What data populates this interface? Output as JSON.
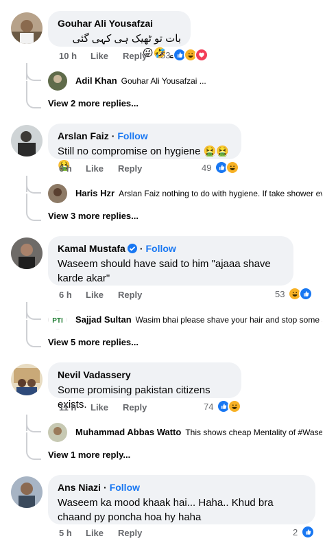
{
  "comments": [
    {
      "author": "Gouhar Ali Yousafzai",
      "text": "بات تو ٹھیک ہی کہی گئی ہے 🤣😜",
      "time": "10 h",
      "like": "Like",
      "reply": "Reply",
      "reactions": "53",
      "reply_preview": {
        "author": "Adil Khan",
        "text": "Gouhar Ali Yousafzai ..."
      },
      "more": "View 2 more replies..."
    },
    {
      "author": "Arslan Faiz",
      "follow": "Follow",
      "text": "Still no compromise on hygiene 🤮🤮🤮",
      "time": "6 h",
      "like": "Like",
      "reply": "Reply",
      "reactions": "49",
      "reply_preview": {
        "author": "Haris Hzr",
        "text": "Arslan Faiz nothing to do with hygiene. If take shower ev..."
      },
      "more": "View 3 more replies..."
    },
    {
      "author": "Kamal Mustafa",
      "follow": "Follow",
      "dot": "·",
      "text": "Waseem should have said to him \"ajaaa shave karde akar\"",
      "time": "6 h",
      "like": "Like",
      "reply": "Reply",
      "reactions": "53",
      "reply_preview": {
        "author": "Sajjad Sultan",
        "text": "Wasim bhai please shave your hair and stop some st..."
      },
      "more": "View 5 more replies..."
    },
    {
      "author": "Nevil Vadassery",
      "text": "Some promising pakistan citizens exists.",
      "time": "11 h",
      "like": "Like",
      "reply": "Reply",
      "reactions": "74",
      "reply_preview": {
        "author": "Muhammad Abbas Watto",
        "text": "This shows cheap Mentality of #Wasee..."
      },
      "more": "View 1 more reply..."
    },
    {
      "author": "Ans Niazi",
      "follow": "Follow",
      "text": "Waseem ka mood khaak hai... Haha.. Khud bra chaand py poncha hoa hy haha",
      "time": "5 h",
      "like": "Like",
      "reply": "Reply",
      "reactions": "2"
    }
  ],
  "icons": {
    "like": "like-reaction-icon",
    "haha": "haha-reaction-icon",
    "love": "love-reaction-icon",
    "sick": "sick-face-emoji",
    "verified": "verified-badge-icon"
  },
  "colors": {
    "accent": "#1877f2",
    "bubble": "#f0f2f5",
    "muted": "#65676b"
  }
}
